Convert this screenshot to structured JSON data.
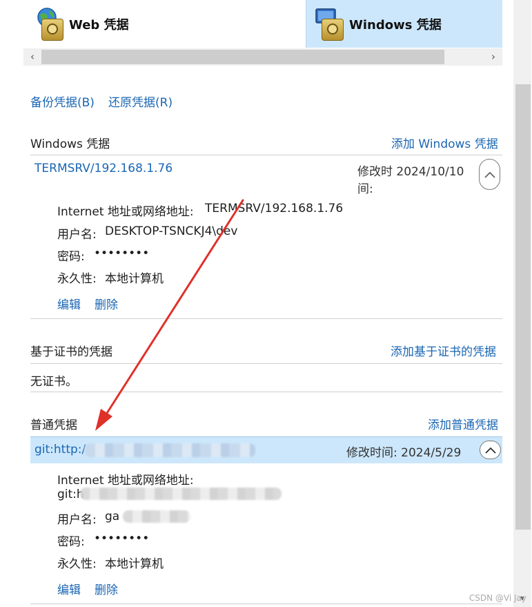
{
  "tabs": {
    "web_label": "Web 凭据",
    "windows_label": "Windows 凭据"
  },
  "actions": {
    "backup": "备份凭据(B)",
    "restore": "还原凭据(R)"
  },
  "windows_section": {
    "title": "Windows 凭据",
    "add_link": "添加 Windows 凭据",
    "entry": {
      "name": "TERMSRV/192.168.1.76",
      "modified_line1": "修改时 2024/10/10",
      "modified_line2": "间:",
      "address_label": "Internet 地址或网络地址:",
      "address_value": "TERMSRV/192.168.1.76",
      "username_label": "用户名:",
      "username_value": "DESKTOP-TSNCKJ4\\dev",
      "password_label": "密码:",
      "password_value": "••••••••",
      "persistence_label": "永久性:",
      "persistence_value": "本地计算机",
      "edit": "编辑",
      "delete": "删除"
    }
  },
  "cert_section": {
    "title": "基于证书的凭据",
    "add_link": "添加基于证书的凭据",
    "empty_text": "无证书。"
  },
  "generic_section": {
    "title": "普通凭据",
    "add_link": "添加普通凭据",
    "entry": {
      "name": "git:http:/",
      "modified": "修改时间:  2024/5/29",
      "address_label": "Internet 地址或网络地址:",
      "address_value": "git:h",
      "username_label": "用户名:",
      "username_value": "ga",
      "password_label": "密码:",
      "password_value": "••••••••",
      "persistence_label": "永久性:",
      "persistence_value": "本地计算机",
      "edit": "编辑",
      "delete": "删除"
    }
  },
  "watermark": "CSDN @Vi Jay",
  "colors": {
    "link": "#1a66b3",
    "selected_tab": "#cce7fb",
    "selected_row": "#cce7fb",
    "arrow": "#e0302a"
  }
}
